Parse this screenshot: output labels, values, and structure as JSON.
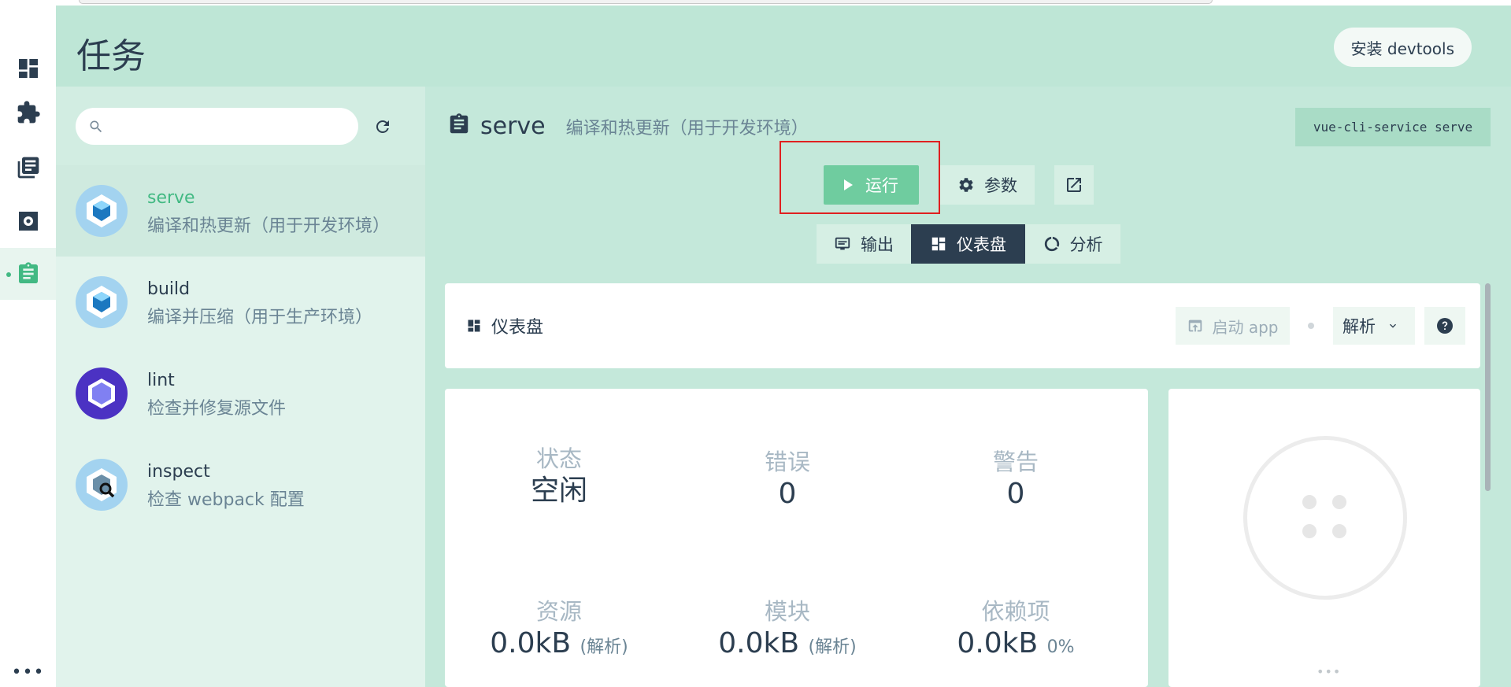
{
  "header": {
    "title": "任务",
    "devtools_label": "安装 devtools"
  },
  "nav": {
    "items": [
      {
        "icon": "dashboard-icon"
      },
      {
        "icon": "plugin-icon"
      },
      {
        "icon": "dependencies-icon"
      },
      {
        "icon": "config-icon"
      },
      {
        "icon": "tasks-icon",
        "active": true
      }
    ],
    "more_label": "•••"
  },
  "task_list": {
    "search_placeholder": "",
    "items": [
      {
        "name": "serve",
        "description": "编译和热更新（用于开发环境）",
        "selected": true
      },
      {
        "name": "build",
        "description": "编译并压缩（用于生产环境）"
      },
      {
        "name": "lint",
        "description": "检查并修复源文件"
      },
      {
        "name": "inspect",
        "description": "检查 webpack 配置"
      }
    ]
  },
  "task": {
    "name": "serve",
    "description": "编译和热更新（用于开发环境）",
    "command": "vue-cli-service serve",
    "run_label": "运行",
    "params_label": "参数"
  },
  "tabs": [
    {
      "label": "输出",
      "icon": "output-icon"
    },
    {
      "label": "仪表盘",
      "icon": "dashboard-icon",
      "active": true
    },
    {
      "label": "分析",
      "icon": "analyze-icon"
    }
  ],
  "dashboard": {
    "title": "仪表盘",
    "launch_label": "启动 app",
    "mode_label": "解析",
    "stats": {
      "status": {
        "label": "状态",
        "value": "空闲"
      },
      "errors": {
        "label": "错误",
        "value": "0"
      },
      "warnings": {
        "label": "警告",
        "value": "0"
      },
      "assets": {
        "label": "资源",
        "value": "0.0kB",
        "note": "(解析)"
      },
      "modules": {
        "label": "模块",
        "value": "0.0kB",
        "note": "(解析)"
      },
      "deps": {
        "label": "依赖项",
        "value": "0.0kB",
        "note": "0%"
      }
    },
    "side_more": "•••"
  },
  "colors": {
    "accent": "#42b983",
    "run_button": "#6fcc9f",
    "dark": "#2c3e50",
    "highlight_border": "#e02020"
  }
}
